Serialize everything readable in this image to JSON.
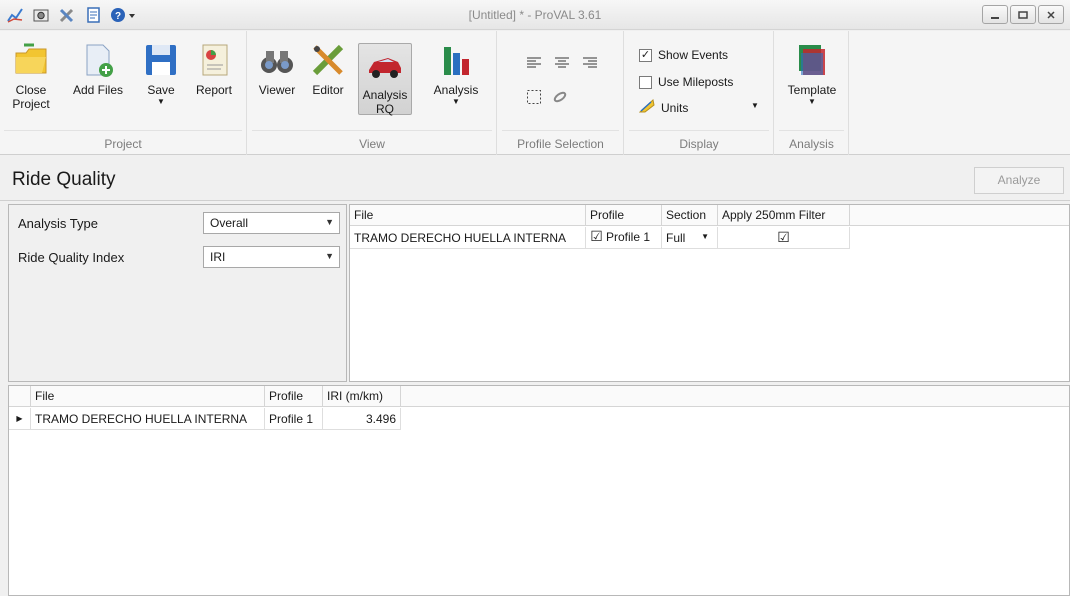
{
  "window": {
    "title": "[Untitled] * - ProVAL 3.61",
    "quick_access_icons": [
      "chart-icon",
      "camera-icon",
      "tools-icon",
      "document-icon",
      "help-icon"
    ]
  },
  "ribbon": {
    "groups": {
      "project": {
        "label": "Project",
        "buttons": {
          "close": "Close Project",
          "close_l1": "Close",
          "close_l2": "Project",
          "add": "Add Files",
          "save": "Save",
          "report": "Report"
        }
      },
      "view": {
        "label": "View",
        "buttons": {
          "viewer": "Viewer",
          "editor": "Editor",
          "analysis_rq_l1": "Analysis",
          "analysis_rq_l2": "RQ",
          "analysis": "Analysis"
        }
      },
      "profile_selection": {
        "label": "Profile Selection"
      },
      "display": {
        "label": "Display",
        "show_events": {
          "label": "Show Events",
          "checked": true
        },
        "use_mileposts": {
          "label": "Use Mileposts",
          "checked": false
        },
        "units": "Units"
      },
      "analysis": {
        "label": "Analysis",
        "template": "Template"
      }
    }
  },
  "page": {
    "title": "Ride Quality",
    "analyze_label": "Analyze"
  },
  "parameters": {
    "analysis_type": {
      "label": "Analysis Type",
      "value": "Overall"
    },
    "ride_quality_index": {
      "label": "Ride Quality Index",
      "value": "IRI"
    }
  },
  "file_grid": {
    "headers": {
      "file": "File",
      "profile": "Profile",
      "section": "Section",
      "filter": "Apply 250mm Filter"
    },
    "rows": [
      {
        "file": "TRAMO DERECHO HUELLA INTERNA",
        "profile_checked": true,
        "profile": "Profile 1",
        "section": "Full",
        "filter_checked": true
      }
    ]
  },
  "results_grid": {
    "headers": {
      "file": "File",
      "profile": "Profile",
      "iri": "IRI (m/km)"
    },
    "rows": [
      {
        "file": "TRAMO DERECHO HUELLA INTERNA",
        "profile": "Profile 1",
        "iri": "3.496"
      }
    ]
  },
  "colors": {
    "accent_blue": "#2a6fc0",
    "folder_yellow": "#f2c531",
    "car_red": "#c2262e"
  }
}
